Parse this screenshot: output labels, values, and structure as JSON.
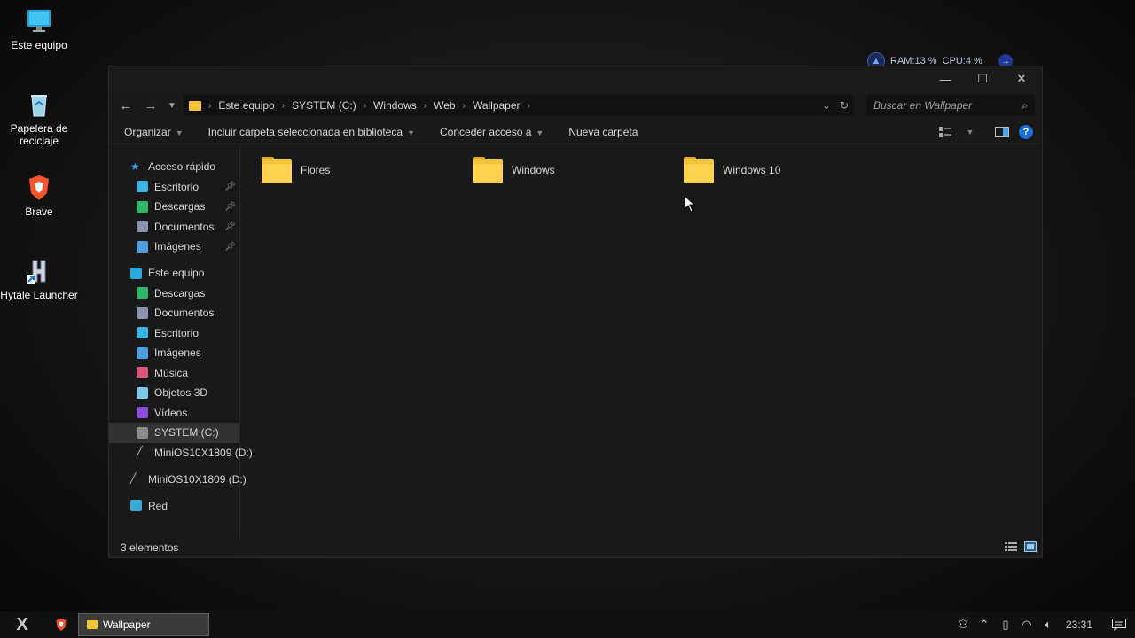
{
  "desktop": {
    "icons": [
      {
        "label": "Este equipo"
      },
      {
        "label": "Papelera de reciclaje"
      },
      {
        "label": "Brave"
      },
      {
        "label": "Hytale Launcher"
      }
    ]
  },
  "widget": {
    "ram": "RAM:13 %",
    "cpu": "CPU:4 %"
  },
  "window": {
    "controls": {
      "minimize": "—",
      "maximize": "☐",
      "close": "✕"
    },
    "breadcrumb": [
      "Este equipo",
      "SYSTEM (C:)",
      "Windows",
      "Web",
      "Wallpaper"
    ],
    "search_placeholder": "Buscar en Wallpaper",
    "toolbar": {
      "organize": "Organizar",
      "include_library": "Incluir carpeta seleccionada en biblioteca",
      "share": "Conceder acceso a",
      "new_folder": "Nueva carpeta"
    },
    "nav": {
      "quick_access": "Acceso rápido",
      "quick_items": [
        "Escritorio",
        "Descargas",
        "Documentos",
        "Imágenes"
      ],
      "this_pc": "Este equipo",
      "pc_items": [
        "Descargas",
        "Documentos",
        "Escritorio",
        "Imágenes",
        "Música",
        "Objetos 3D",
        "Vídeos",
        "SYSTEM (C:)",
        "MiniOS10X1809 (D:)"
      ],
      "drive_d": "MiniOS10X1809 (D:)",
      "network": "Red"
    },
    "files": [
      "Flores",
      "Windows",
      "Windows 10"
    ],
    "status": "3 elementos"
  },
  "taskbar": {
    "start_glyph": "X",
    "task_label": "Wallpaper",
    "clock": "23:31",
    "colors": {
      "brave": "#fb542b",
      "folder": "#f5c43a",
      "accent": "#1b6ed6"
    }
  }
}
